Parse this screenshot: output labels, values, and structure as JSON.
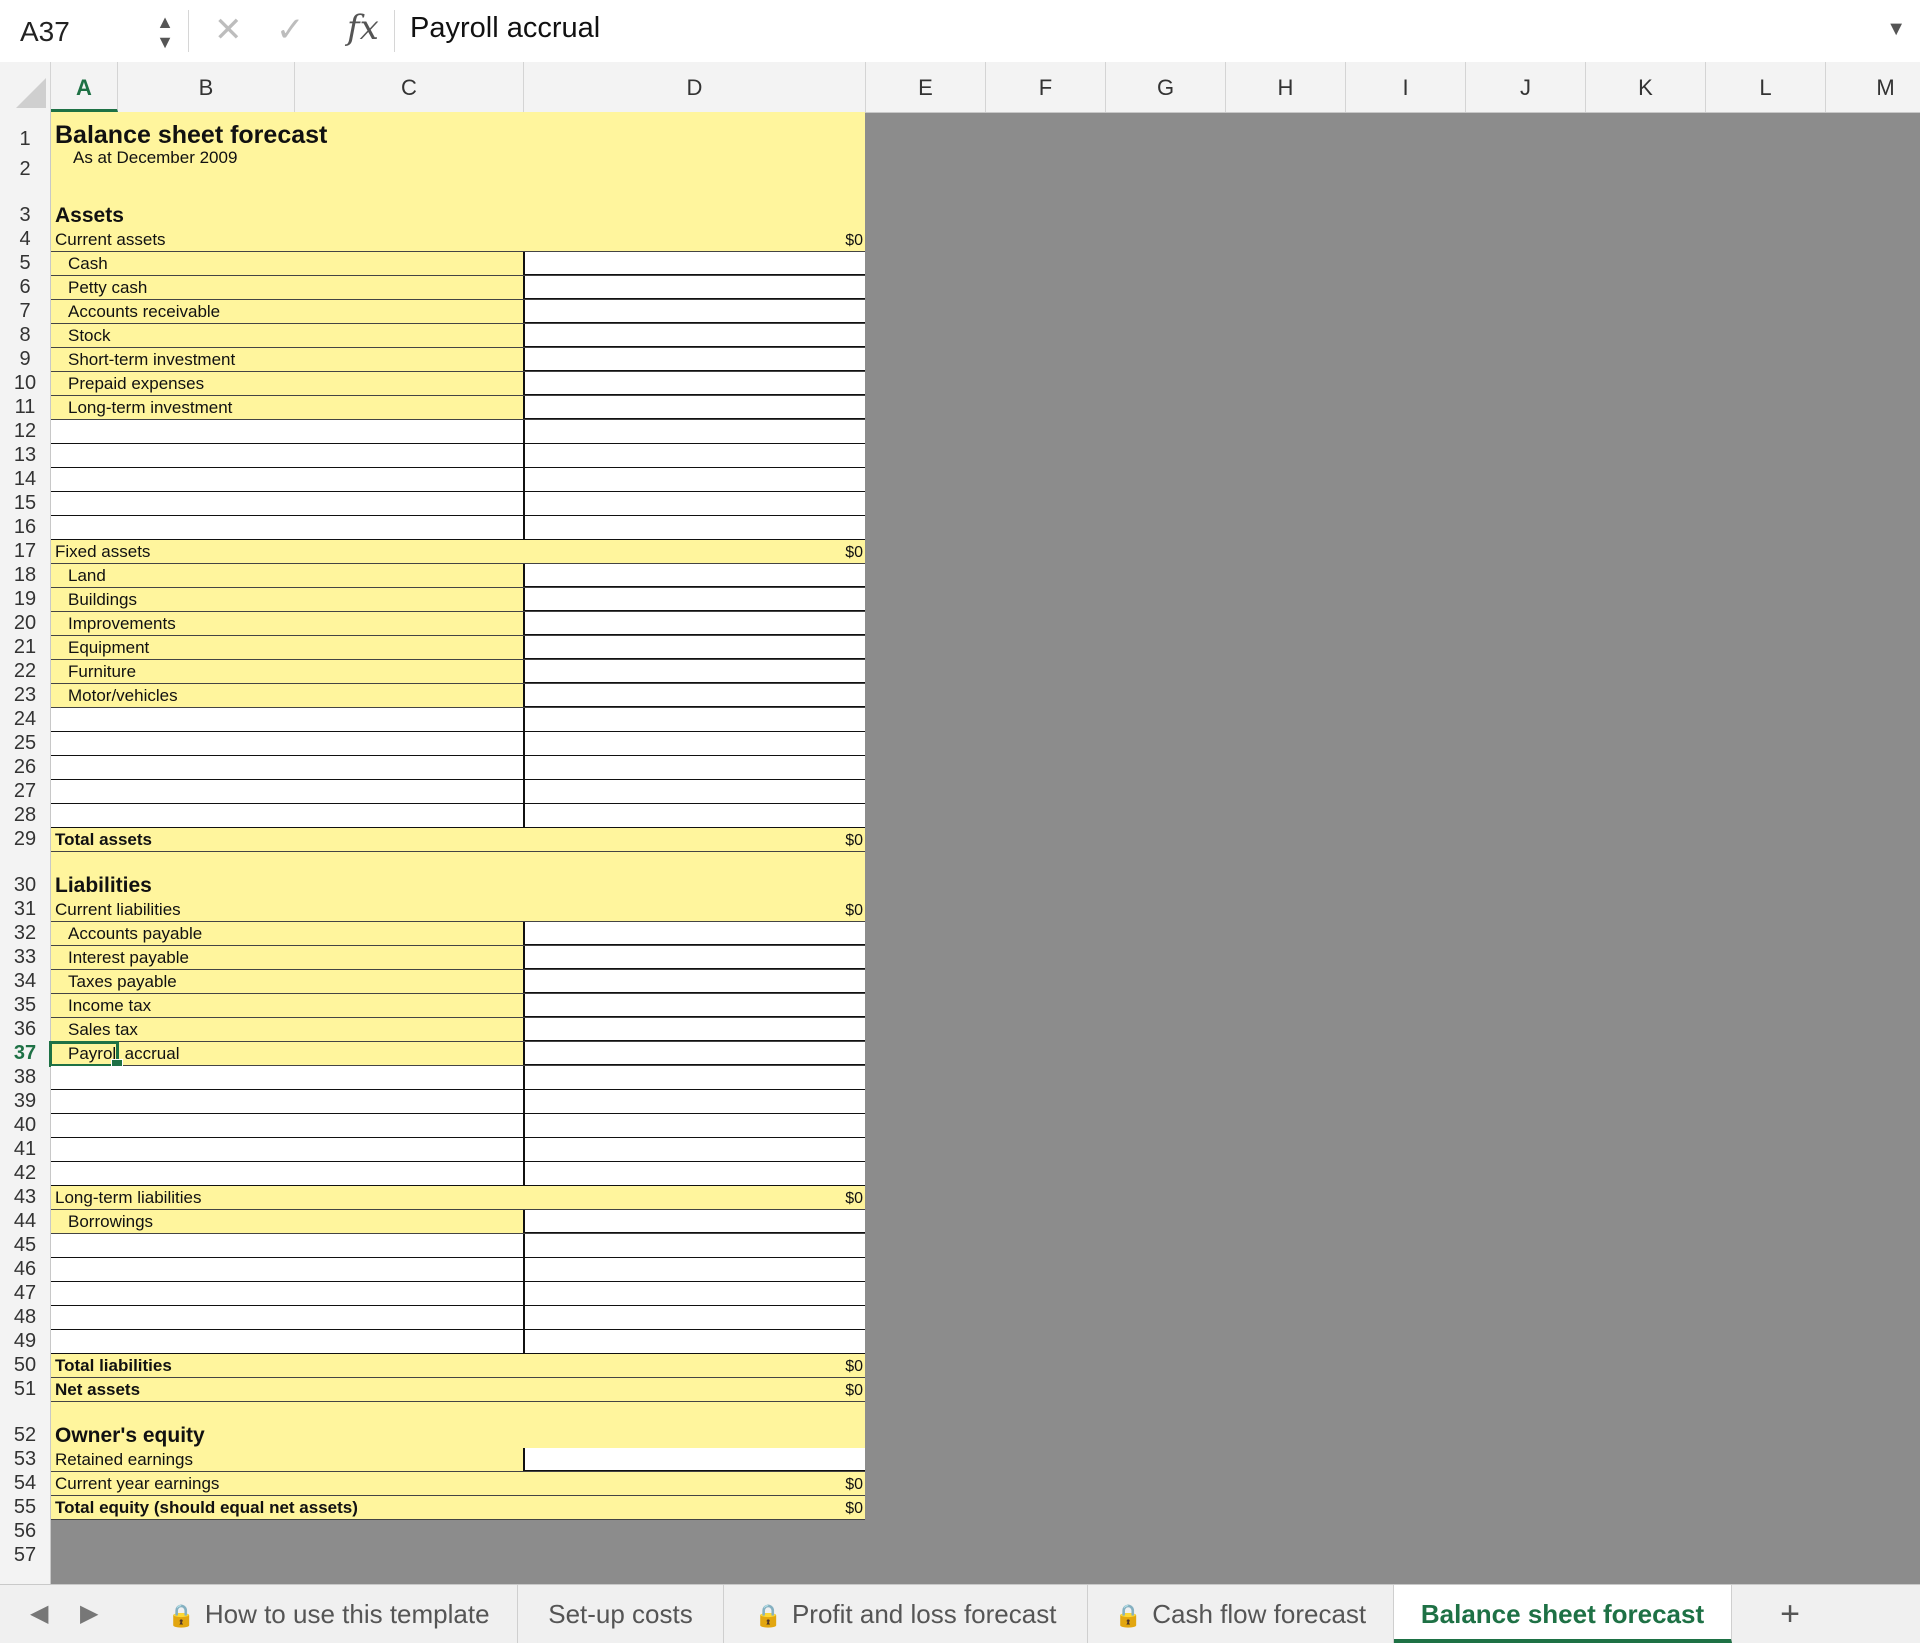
{
  "formula_bar": {
    "name_box": "A37",
    "cancel_icon": "close-icon",
    "enter_icon": "check-icon",
    "fx_label": "fx",
    "content": "Payroll accrual"
  },
  "columns": [
    "A",
    "B",
    "C",
    "D",
    "E",
    "F",
    "G",
    "H",
    "I",
    "J",
    "K",
    "L",
    "M"
  ],
  "active_column": "A",
  "active_row": "37",
  "sheet": {
    "title": "Balance sheet forecast",
    "subtitle": "As at December 2009",
    "rows": [
      {
        "n": "1",
        "type": "title",
        "label": "Balance sheet forecast"
      },
      {
        "n": "2",
        "type": "subtitle",
        "label": "As at December 2009"
      },
      {
        "n": "3",
        "type": "section",
        "label": "Assets"
      },
      {
        "n": "4",
        "type": "group",
        "label": "Current assets",
        "value": "$0"
      },
      {
        "n": "5",
        "type": "item",
        "label": "Cash"
      },
      {
        "n": "6",
        "type": "item",
        "label": "Petty cash"
      },
      {
        "n": "7",
        "type": "item",
        "label": "Accounts receivable"
      },
      {
        "n": "8",
        "type": "item",
        "label": "Stock"
      },
      {
        "n": "9",
        "type": "item",
        "label": "Short-term investment"
      },
      {
        "n": "10",
        "type": "item",
        "label": "Prepaid expenses"
      },
      {
        "n": "11",
        "type": "item",
        "label": "Long-term investment"
      },
      {
        "n": "12",
        "type": "blank"
      },
      {
        "n": "13",
        "type": "blank"
      },
      {
        "n": "14",
        "type": "blank"
      },
      {
        "n": "15",
        "type": "blank"
      },
      {
        "n": "16",
        "type": "blank"
      },
      {
        "n": "17",
        "type": "group",
        "label": "Fixed assets",
        "value": "$0"
      },
      {
        "n": "18",
        "type": "item",
        "label": "Land"
      },
      {
        "n": "19",
        "type": "item",
        "label": "Buildings"
      },
      {
        "n": "20",
        "type": "item",
        "label": "Improvements"
      },
      {
        "n": "21",
        "type": "item",
        "label": "Equipment"
      },
      {
        "n": "22",
        "type": "item",
        "label": "Furniture"
      },
      {
        "n": "23",
        "type": "item",
        "label": "Motor/vehicles"
      },
      {
        "n": "24",
        "type": "blank"
      },
      {
        "n": "25",
        "type": "blank"
      },
      {
        "n": "26",
        "type": "blank"
      },
      {
        "n": "27",
        "type": "blank"
      },
      {
        "n": "28",
        "type": "blank"
      },
      {
        "n": "29",
        "type": "total",
        "label": "Total assets",
        "value": "$0"
      },
      {
        "n": "30",
        "type": "section",
        "label": "Liabilities"
      },
      {
        "n": "31",
        "type": "group",
        "label": "Current liabilities",
        "value": "$0"
      },
      {
        "n": "32",
        "type": "item",
        "label": "Accounts payable"
      },
      {
        "n": "33",
        "type": "item",
        "label": "Interest payable"
      },
      {
        "n": "34",
        "type": "item",
        "label": "Taxes payable"
      },
      {
        "n": "35",
        "type": "item",
        "label": "Income tax"
      },
      {
        "n": "36",
        "type": "item",
        "label": "Sales tax"
      },
      {
        "n": "37",
        "type": "item",
        "label": "Payroll accrual",
        "selected": true
      },
      {
        "n": "38",
        "type": "blank"
      },
      {
        "n": "39",
        "type": "blank"
      },
      {
        "n": "40",
        "type": "blank"
      },
      {
        "n": "41",
        "type": "blank"
      },
      {
        "n": "42",
        "type": "blank"
      },
      {
        "n": "43",
        "type": "group",
        "label": "Long-term liabilities",
        "value": "$0"
      },
      {
        "n": "44",
        "type": "item",
        "label": "Borrowings"
      },
      {
        "n": "45",
        "type": "blank"
      },
      {
        "n": "46",
        "type": "blank"
      },
      {
        "n": "47",
        "type": "blank"
      },
      {
        "n": "48",
        "type": "blank"
      },
      {
        "n": "49",
        "type": "blank"
      },
      {
        "n": "50",
        "type": "total",
        "label": "Total liabilities",
        "value": "$0"
      },
      {
        "n": "51",
        "type": "total",
        "label": "Net assets",
        "value": "$0"
      },
      {
        "n": "52",
        "type": "section",
        "label": "Owner's equity"
      },
      {
        "n": "53",
        "type": "group-input",
        "label": "Retained earnings"
      },
      {
        "n": "54",
        "type": "group",
        "label": "Current year earnings",
        "value": "$0"
      },
      {
        "n": "55",
        "type": "total",
        "label": "Total equity (should equal net assets)",
        "value": "$0"
      },
      {
        "n": "56",
        "type": "empty"
      },
      {
        "n": "57",
        "type": "empty"
      }
    ]
  },
  "tabs": [
    {
      "label": "How to use this template",
      "locked": true,
      "active": false
    },
    {
      "label": "Set-up costs",
      "locked": false,
      "active": false
    },
    {
      "label": "Profit and loss forecast",
      "locked": true,
      "active": false
    },
    {
      "label": "Cash flow forecast",
      "locked": true,
      "active": false
    },
    {
      "label": "Balance sheet forecast",
      "locked": false,
      "active": true
    }
  ],
  "tab_nav": {
    "prev_icon": "chevron-left-icon",
    "next_icon": "chevron-right-icon",
    "add_icon": "plus-icon",
    "add_label": "+"
  },
  "colors": {
    "highlight": "#fff59d",
    "accent": "#1e7145",
    "background": "#8c8c8c"
  }
}
